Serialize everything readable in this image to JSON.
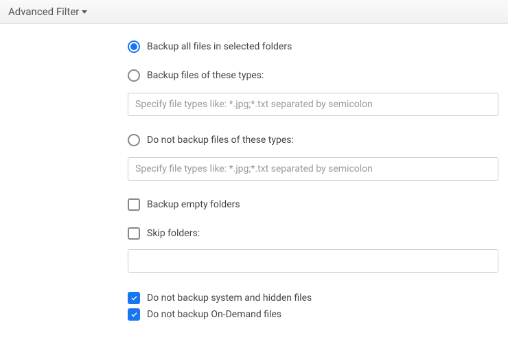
{
  "header": {
    "title": "Advanced Filter"
  },
  "options": {
    "backup_all": {
      "label": "Backup all files in selected folders",
      "selected": true
    },
    "backup_types": {
      "label": "Backup files of these types:",
      "selected": false,
      "placeholder": "Specify file types like: *.jpg;*.txt separated by semicolon",
      "value": ""
    },
    "exclude_types": {
      "label": "Do not backup files of these types:",
      "selected": false,
      "placeholder": "Specify file types like: *.jpg;*.txt separated by semicolon",
      "value": ""
    },
    "backup_empty": {
      "label": "Backup empty folders",
      "checked": false
    },
    "skip_folders": {
      "label": "Skip folders:",
      "checked": false,
      "value": ""
    },
    "exclude_system": {
      "label": "Do not backup system and hidden files",
      "checked": true
    },
    "exclude_ondemand": {
      "label": "Do not backup On-Demand files",
      "checked": true
    }
  }
}
